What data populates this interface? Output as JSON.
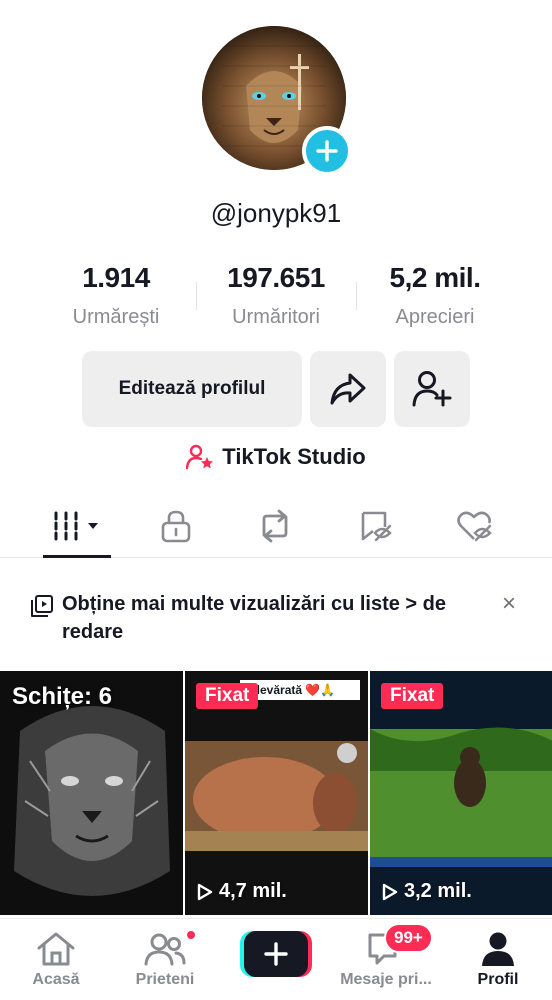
{
  "profile": {
    "username": "@jonypk91",
    "stats": [
      {
        "value": "1.914",
        "label": "Urmărești"
      },
      {
        "value": "197.651",
        "label": "Urmăritori"
      },
      {
        "value": "5,2 mil.",
        "label": "Aprecieri"
      }
    ],
    "edit_label": "Editează profilul",
    "studio_label": "TikTok Studio"
  },
  "tabs": [
    "videos-icon",
    "lock-icon",
    "repost-icon",
    "favorites-icon",
    "liked-icon"
  ],
  "banner": {
    "text": "Obține mai multe vizualizări cu liste > de redare",
    "close": "×"
  },
  "grid": {
    "drafts_label": "Schițe: 6",
    "videos": [
      {
        "pinned": "Fixat",
        "caption": "adevărată ❤️🙏",
        "views": "4,7 mil."
      },
      {
        "pinned": "Fixat",
        "caption": "",
        "views": "3,2 mil."
      }
    ]
  },
  "nav": {
    "home": "Acasă",
    "friends": "Prieteni",
    "messages": "Mesaje pri...",
    "messages_badge": "99+",
    "profile": "Profil"
  },
  "colors": {
    "accent": "#fe2c55",
    "cyan": "#25f4ee",
    "avatar_plus": "#22bfe3"
  }
}
